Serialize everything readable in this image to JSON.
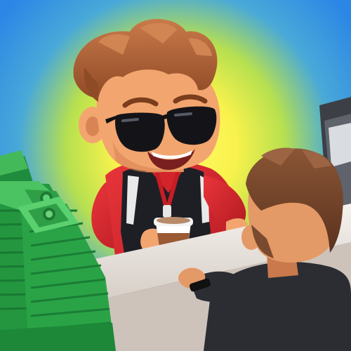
{
  "scene": {
    "type": "game-app-icon",
    "characters": [
      "barista",
      "customer"
    ],
    "props": [
      "coffee-cup",
      "cash-stacks",
      "counter",
      "coffee-machine"
    ]
  },
  "colors": {
    "glow_center": "#fff95a",
    "glow_mid": "#d7e84a",
    "sky": "#2f8fe8",
    "hair": "#b7683d",
    "hair_dark": "#8f4a26",
    "skin": "#f2a56e",
    "skin_shade": "#d98454",
    "jacket_red": "#d9252b",
    "vest_black": "#1d1d22",
    "money": "#2fa64b",
    "money_dark": "#1d7a34",
    "money_light": "#6fd27a",
    "counter": "#efe9e3",
    "counter_shade": "#d3cbc4",
    "customer_hair": "#7a4a30",
    "customer_shirt": "#2b2d33",
    "cup": "#ffffff",
    "cup_sleeve": "#9b5a33"
  }
}
